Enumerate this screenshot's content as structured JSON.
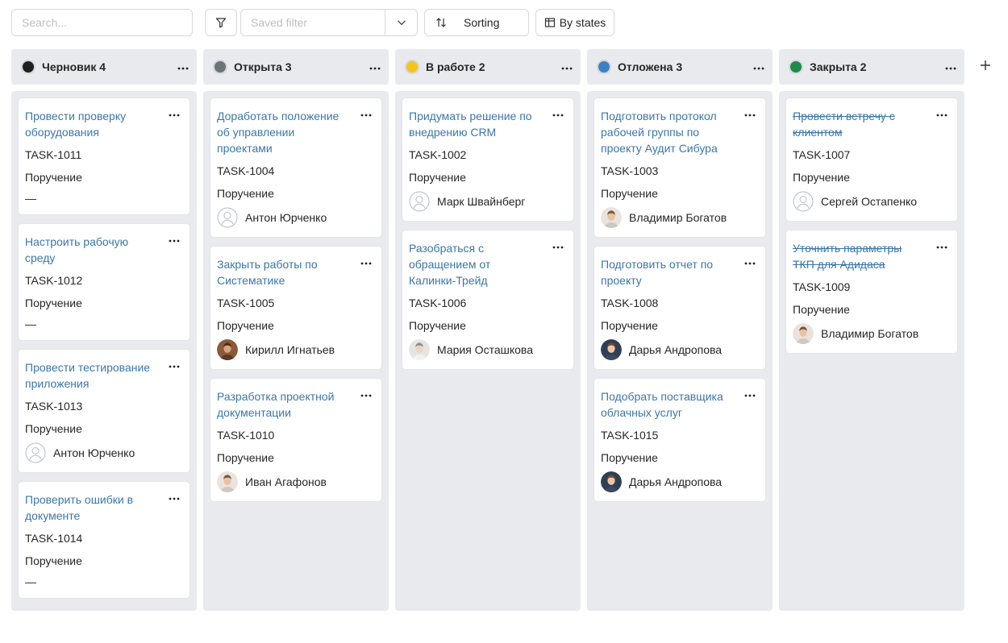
{
  "toolbar": {
    "search_placeholder": "Search...",
    "saved_filter_placeholder": "Saved filter",
    "sorting_label": "Sorting",
    "by_states_label": "By states"
  },
  "icons": {
    "filter": "filter-icon",
    "chevron": "chevron-down-icon",
    "sort": "sort-icon",
    "columns": "columns-icon",
    "more": "more-horizontal-icon",
    "plus": "plus-icon"
  },
  "add_column_label": "+",
  "columns": [
    {
      "title": "Черновик",
      "count": "4",
      "color": "#1f1f1f",
      "cards": [
        {
          "title": "Провести проверку оборудования",
          "id": "TASK-1011",
          "type": "Поручение",
          "assignee": "—",
          "avatar": "none",
          "done": false
        },
        {
          "title": "Настроить рабочую среду",
          "id": "TASK-1012",
          "type": "Поручение",
          "assignee": "—",
          "avatar": "none",
          "done": false
        },
        {
          "title": "Провести тестирование приложения",
          "id": "TASK-1013",
          "type": "Поручение",
          "assignee": "Антон Юрченко",
          "avatar": "placeholder",
          "done": false
        },
        {
          "title": "Проверить ошибки в документе",
          "id": "TASK-1014",
          "type": "Поручение",
          "assignee": "—",
          "avatar": "none",
          "done": false
        }
      ]
    },
    {
      "title": "Открыта",
      "count": "3",
      "color": "#6e7378",
      "cards": [
        {
          "title": "Доработать положение об управлении проектами",
          "id": "TASK-1004",
          "type": "Поручение",
          "assignee": "Антон Юрченко",
          "avatar": "placeholder",
          "done": false
        },
        {
          "title": "Закрыть работы по Систематике",
          "id": "TASK-1005",
          "type": "Поручение",
          "assignee": "Кирилл Игнатьев",
          "avatar": "photo-brown",
          "done": false
        },
        {
          "title": "Разработка проектной документации",
          "id": "TASK-1010",
          "type": "Поручение",
          "assignee": "Иван Агафонов",
          "avatar": "photo-light",
          "done": false
        }
      ]
    },
    {
      "title": "В работе",
      "count": "2",
      "color": "#f5c518",
      "cards": [
        {
          "title": "Придумать решение по внедрению CRM",
          "id": "TASK-1002",
          "type": "Поручение",
          "assignee": "Марк Швайнберг",
          "avatar": "placeholder",
          "done": false
        },
        {
          "title": "Разобраться с обращением от Калинки-Трейд",
          "id": "TASK-1006",
          "type": "Поручение",
          "assignee": "Мария Осташкова",
          "avatar": "photo-grey",
          "done": false
        }
      ]
    },
    {
      "title": "Отложена",
      "count": "3",
      "color": "#3b82c4",
      "cards": [
        {
          "title": "Подготовить протокол рабочей группы по проекту Аудит Сибура",
          "id": "TASK-1003",
          "type": "Поручение",
          "assignee": "Владимир Богатов",
          "avatar": "photo-light",
          "done": false
        },
        {
          "title": "Подготовить отчет по проекту",
          "id": "TASK-1008",
          "type": "Поручение",
          "assignee": "Дарья Андропова",
          "avatar": "photo-dark",
          "done": false
        },
        {
          "title": "Подобрать поставщика облачных услуг",
          "id": "TASK-1015",
          "type": "Поручение",
          "assignee": "Дарья Андропова",
          "avatar": "photo-dark",
          "done": false
        }
      ]
    },
    {
      "title": "Закрыта",
      "count": "2",
      "color": "#1e8a4c",
      "cards": [
        {
          "title": "Провести встречу с клиентом",
          "id": "TASK-1007",
          "type": "Поручение",
          "assignee": "Сергей Остапенко",
          "avatar": "placeholder",
          "done": true
        },
        {
          "title": "Уточнить параметры ТКП для Адидаса",
          "id": "TASK-1009",
          "type": "Поручение",
          "assignee": "Владимир Богатов",
          "avatar": "photo-light",
          "done": true
        }
      ]
    }
  ]
}
